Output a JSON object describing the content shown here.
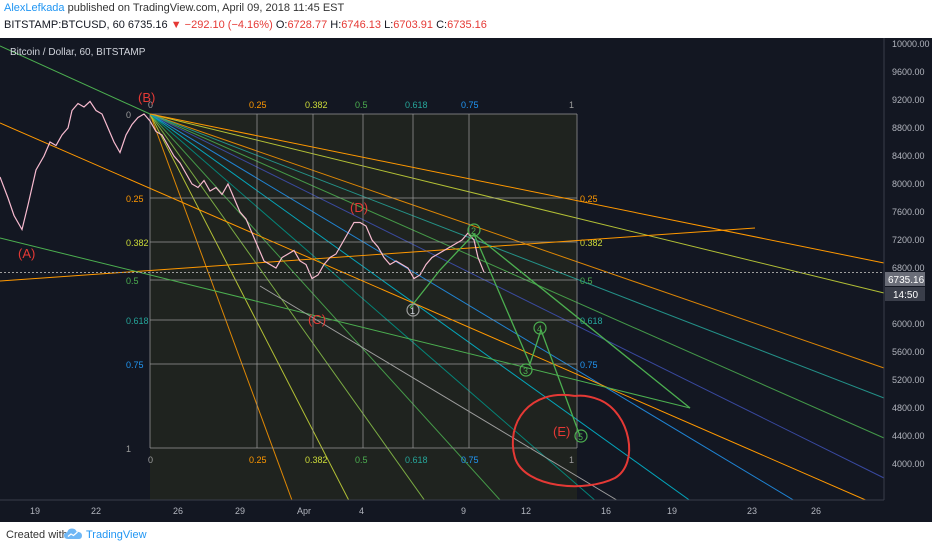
{
  "header": {
    "author": "AlexLefkada",
    "published_text": "published on TradingView.com, April 09, 2018 11:45 EST",
    "symbol": "BITSTAMP:BTCUSD, 60",
    "last": "6735.16",
    "change": "−292.10 (−4.16%)",
    "o_label": "O:",
    "o_value": "6728.77",
    "h_label": "H:",
    "h_value": "6746.13",
    "l_label": "L:",
    "l_value": "6703.91",
    "c_label": "C:",
    "c_value": "6735.16"
  },
  "footer": {
    "created_with": "Created with",
    "brand": "TradingView"
  },
  "colors": {
    "background": "#131722",
    "up_candle": "#f8bbd0",
    "down_candle": "#ffffff",
    "price_line": "#9e9e9e",
    "gann_box": "#9e9e9e",
    "annotation_red": "#e53935",
    "wave_green": "#4caf50",
    "current_price_tag": "#9e9e9e"
  },
  "chart_data": {
    "type": "line",
    "title": "Bitcoin / Dollar, 60, BITSTAMP",
    "x_tick_labels": [
      "19",
      "22",
      "26",
      "29",
      "Apr",
      "4",
      "9",
      "12",
      "16",
      "19",
      "23",
      "26"
    ],
    "y_tick_labels": [
      "10000.00",
      "9600.00",
      "9200.00",
      "8800.00",
      "8400.00",
      "8000.00",
      "7600.00",
      "7200.00",
      "6800.00",
      "6400.00",
      "6000.00",
      "5600.00",
      "5200.00",
      "4800.00",
      "4400.00",
      "4000.00"
    ],
    "ylim": [
      3800,
      10000
    ],
    "current_price": "6735.16",
    "current_time_tag": "14:50",
    "series": [
      {
        "values": [
          [
            0,
            8100
          ],
          [
            8,
            7800
          ],
          [
            14,
            7550
          ],
          [
            22,
            7350
          ],
          [
            28,
            7700
          ],
          [
            36,
            8200
          ],
          [
            44,
            8400
          ],
          [
            50,
            8600
          ],
          [
            56,
            8550
          ],
          [
            62,
            8700
          ],
          [
            68,
            8800
          ],
          [
            72,
            9050
          ],
          [
            78,
            9150
          ],
          [
            84,
            9100
          ],
          [
            90,
            9180
          ],
          [
            96,
            9050
          ],
          [
            102,
            9000
          ],
          [
            108,
            8800
          ],
          [
            114,
            8600
          ],
          [
            120,
            8450
          ],
          [
            126,
            8700
          ],
          [
            132,
            8850
          ],
          [
            138,
            8950
          ],
          [
            144,
            9000
          ],
          [
            150,
            8900
          ],
          [
            156,
            8750
          ],
          [
            162,
            8700
          ],
          [
            168,
            8550
          ],
          [
            174,
            8400
          ],
          [
            180,
            8300
          ],
          [
            186,
            8150
          ],
          [
            192,
            8000
          ],
          [
            198,
            7950
          ],
          [
            204,
            8050
          ],
          [
            210,
            7900
          ],
          [
            216,
            7950
          ],
          [
            222,
            7850
          ],
          [
            228,
            8000
          ],
          [
            234,
            7800
          ],
          [
            240,
            7600
          ],
          [
            246,
            7500
          ],
          [
            252,
            7300
          ],
          [
            258,
            7100
          ],
          [
            264,
            6900
          ],
          [
            270,
            6850
          ],
          [
            276,
            6800
          ],
          [
            282,
            6950
          ],
          [
            288,
            7000
          ],
          [
            294,
            7050
          ],
          [
            300,
            6900
          ],
          [
            306,
            6850
          ],
          [
            312,
            6650
          ],
          [
            318,
            6700
          ],
          [
            324,
            6850
          ],
          [
            330,
            6950
          ],
          [
            336,
            7000
          ],
          [
            342,
            7150
          ],
          [
            348,
            7300
          ],
          [
            354,
            7450
          ],
          [
            360,
            7450
          ],
          [
            366,
            7400
          ],
          [
            372,
            7200
          ],
          [
            378,
            7100
          ],
          [
            384,
            6950
          ],
          [
            390,
            6850
          ],
          [
            396,
            6900
          ],
          [
            402,
            6850
          ],
          [
            408,
            6800
          ],
          [
            414,
            6650
          ],
          [
            420,
            6700
          ],
          [
            426,
            6850
          ],
          [
            432,
            6950
          ],
          [
            438,
            7000
          ],
          [
            444,
            7050
          ],
          [
            450,
            7100
          ],
          [
            456,
            7150
          ],
          [
            462,
            7200
          ],
          [
            468,
            7300
          ],
          [
            474,
            7200
          ],
          [
            478,
            6950
          ],
          [
            484,
            6740
          ]
        ]
      }
    ],
    "gann_levels_left": [
      "0",
      "0.25",
      "0.382",
      "0.5",
      "0.618",
      "0.75",
      "1"
    ],
    "gann_levels_top": [
      "0",
      "0.25",
      "0.382",
      "0.5",
      "0.618",
      "0.75",
      "1"
    ],
    "annotations": [
      "(A)",
      "(B)",
      "(C)",
      "(D)",
      "(E)",
      "1",
      "2",
      "3",
      "4",
      "5"
    ]
  }
}
